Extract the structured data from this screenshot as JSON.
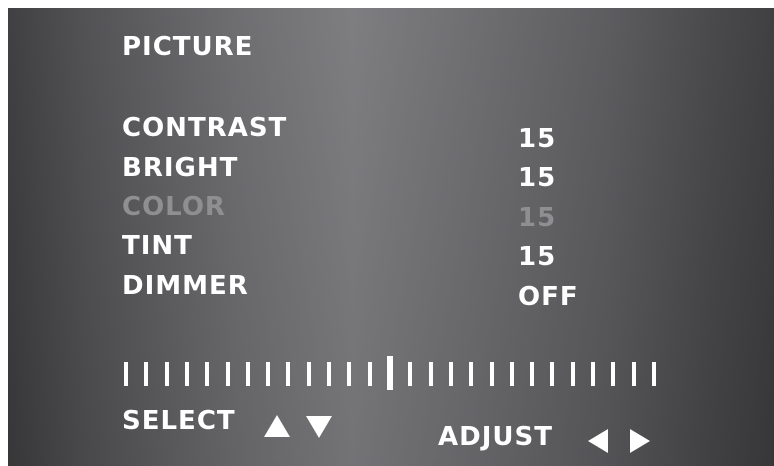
{
  "menu": {
    "title": "PICTURE",
    "items": [
      {
        "label": "CONTRAST",
        "value": "15",
        "state": "enabled"
      },
      {
        "label": "BRIGHT",
        "value": "15",
        "state": "enabled"
      },
      {
        "label": "COLOR",
        "value": "15",
        "state": "disabled"
      },
      {
        "label": "TINT",
        "value": "15",
        "state": "enabled"
      },
      {
        "label": "DIMMER",
        "value": "OFF",
        "state": "enabled"
      }
    ]
  },
  "scale": {
    "tick_count": 27,
    "center_index": 13
  },
  "footer": {
    "select_label": "SELECT",
    "adjust_label": "ADJUST"
  },
  "icons": {
    "select_up": "triangle-up-icon",
    "select_down": "triangle-down-icon",
    "adjust_left": "triangle-left-icon",
    "adjust_right": "triangle-right-icon"
  },
  "colors": {
    "text": "#ffffff",
    "disabled_text": "#8f8f92",
    "screen_dark": "#3a3a3c",
    "screen_light": "#7a7a7d"
  }
}
